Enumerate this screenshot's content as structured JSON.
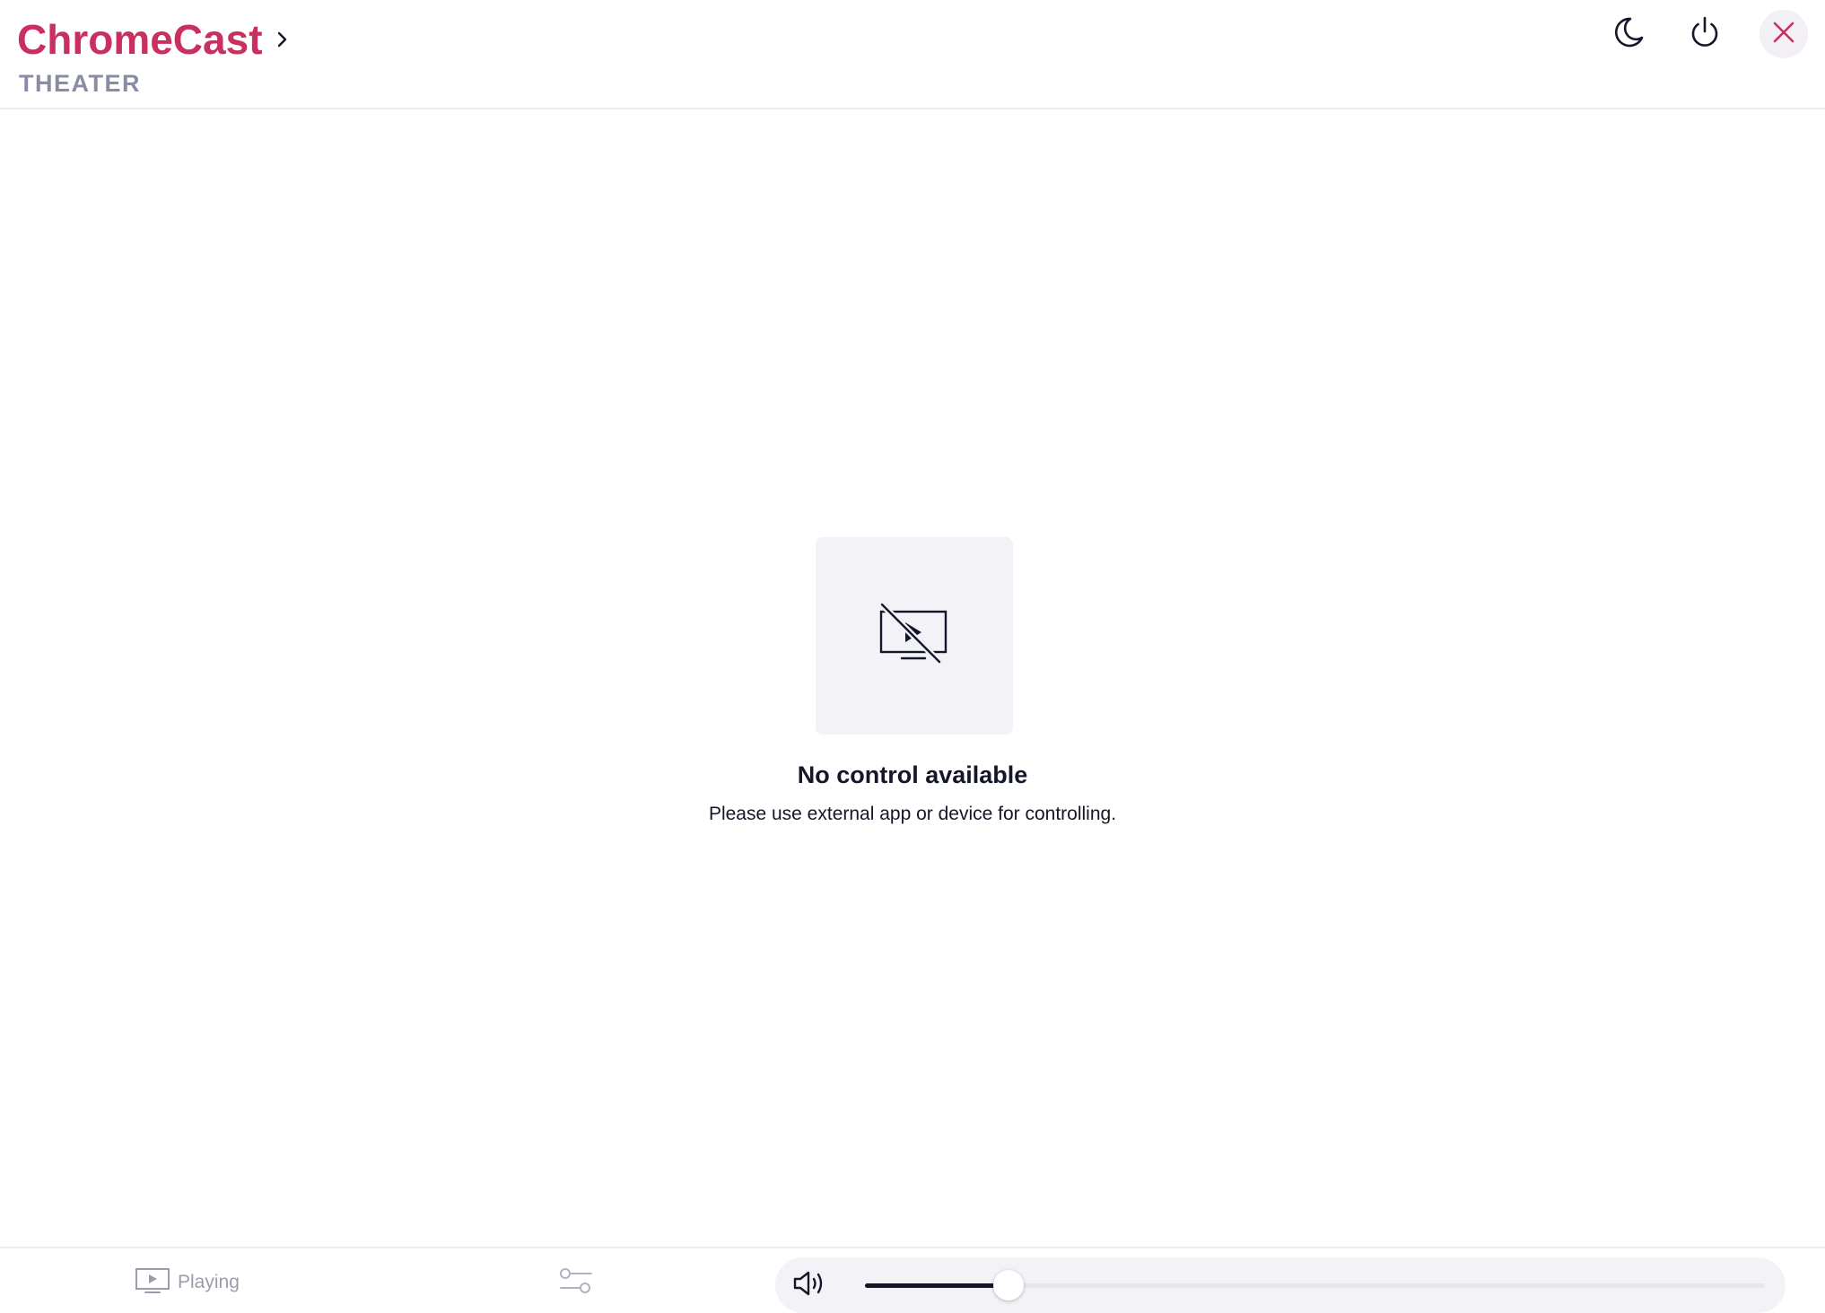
{
  "header": {
    "device_name": "ChromeCast",
    "room_name": "THEATER",
    "icons": {
      "chevron": "chevron-right-icon",
      "night": "moon-icon",
      "power": "power-icon",
      "close": "close-icon"
    }
  },
  "empty_state": {
    "icon": "no-cast-icon",
    "title": "No control available",
    "description": "Please use external app or device for controlling."
  },
  "bottom_bar": {
    "playing_tab_label": "Playing",
    "playing_icon": "screen-play-icon",
    "settings_icon": "sliders-icon",
    "volume_icon": "volume-icon",
    "volume_level": 0.16
  },
  "colors": {
    "accent": "#c9305f",
    "muted": "#8a8ca6",
    "text": "#14162a",
    "tile_bg": "#f3f3f7"
  }
}
